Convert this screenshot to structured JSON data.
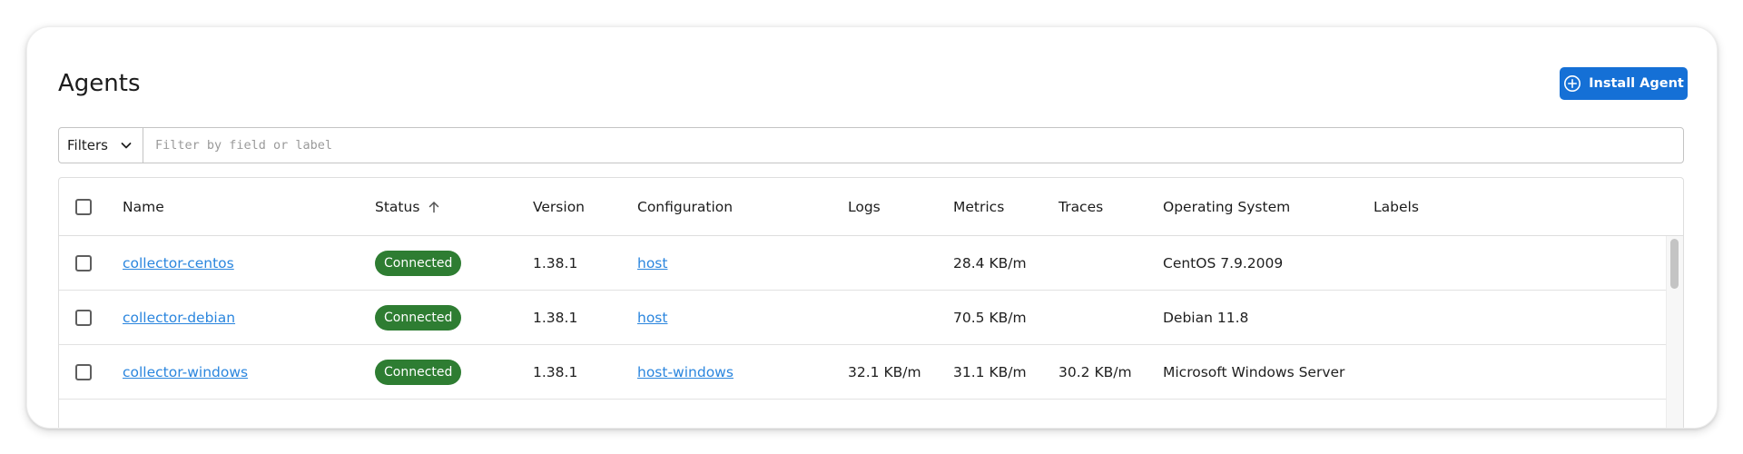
{
  "page": {
    "title": "Agents",
    "install_button_label": "Install Agent"
  },
  "filters": {
    "dropdown_label": "Filters",
    "input_value": "",
    "input_placeholder": "Filter by field or label"
  },
  "table": {
    "columns": [
      "Name",
      "Status",
      "Version",
      "Configuration",
      "Logs",
      "Metrics",
      "Traces",
      "Operating System",
      "Labels"
    ],
    "sorted_column": "Status",
    "sort_direction": "ascending",
    "rows": [
      {
        "name": "collector-centos",
        "status": "Connected",
        "version": "1.38.1",
        "configuration": "host",
        "logs": "",
        "metrics": "28.4 KB/m",
        "traces": "",
        "os": "CentOS 7.9.2009",
        "labels": ""
      },
      {
        "name": "collector-debian",
        "status": "Connected",
        "version": "1.38.1",
        "configuration": "host",
        "logs": "",
        "metrics": "70.5 KB/m",
        "traces": "",
        "os": "Debian 11.8",
        "labels": ""
      },
      {
        "name": "collector-windows",
        "status": "Connected",
        "version": "1.38.1",
        "configuration": "host-windows",
        "logs": "32.1 KB/m",
        "metrics": "31.1 KB/m",
        "traces": "30.2 KB/m",
        "os": "Microsoft Windows Server",
        "labels": ""
      }
    ]
  },
  "colors": {
    "primary": "#1570d6",
    "link": "#2b86de",
    "status_connected": "#2e7d32"
  },
  "icons": {
    "install": "plus-circle-icon",
    "filters_dropdown": "chevron-down-icon",
    "sort": "arrow-up-icon"
  }
}
